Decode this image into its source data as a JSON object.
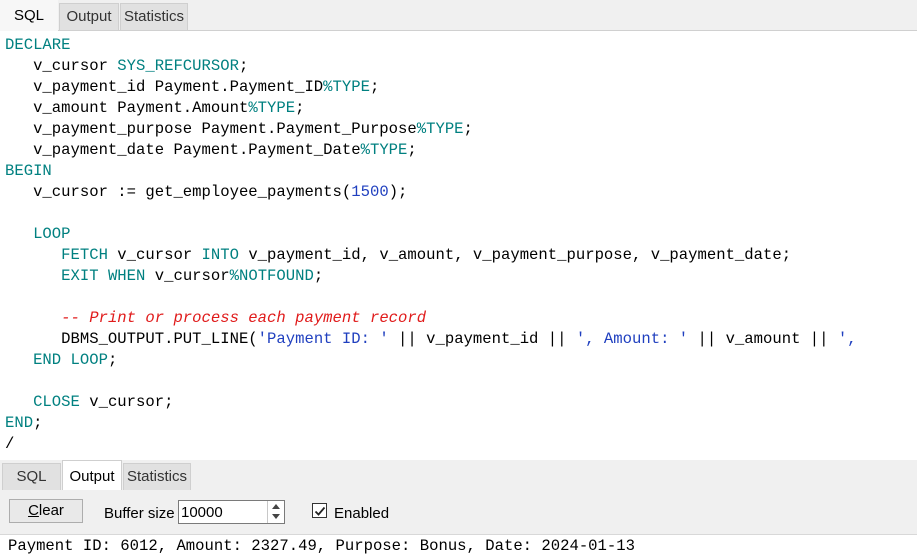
{
  "top_tabs": [
    {
      "label": "SQL",
      "active": true
    },
    {
      "label": "Output",
      "active": false
    },
    {
      "label": "Statistics",
      "active": false
    }
  ],
  "code": {
    "l1": "DECLARE",
    "l2a": "   v_cursor ",
    "l2b": "SYS_REFCURSOR",
    "l2c": ";",
    "l3a": "   v_payment_id Payment.Payment_ID",
    "l3b": "%TYPE",
    "l3c": ";",
    "l4a": "   v_amount Payment.Amount",
    "l4b": "%TYPE",
    "l4c": ";",
    "l5a": "   v_payment_purpose Payment.Payment_Purpose",
    "l5b": "%TYPE",
    "l5c": ";",
    "l6a": "   v_payment_date Payment.Payment_Date",
    "l6b": "%TYPE",
    "l6c": ";",
    "l7": "BEGIN",
    "l8a": "   v_cursor := get_employee_payments(",
    "l8b": "1500",
    "l8c": ");",
    "l10a": "   ",
    "l10b": "LOOP",
    "l11a": "      ",
    "l11b": "FETCH",
    "l11c": " v_cursor ",
    "l11d": "INTO",
    "l11e": " v_payment_id, v_amount, v_payment_purpose, v_payment_date;",
    "l12a": "      ",
    "l12b": "EXIT WHEN",
    "l12c": " v_cursor",
    "l12d": "%NOTFOUND",
    "l12e": ";",
    "l14a": "      ",
    "l14b": "-- Print or process each payment record",
    "l15a": "      DBMS_OUTPUT.PUT_LINE(",
    "l15b": "'Payment ID: '",
    "l15c": " || v_payment_id || ",
    "l15d": "', Amount: '",
    "l15e": " || v_amount || ",
    "l15f": "',",
    "l16a": "   ",
    "l16b": "END LOOP",
    "l16c": ";",
    "l18a": "   ",
    "l18b": "CLOSE",
    "l18c": " v_cursor;",
    "l19a": "END",
    "l19b": ";",
    "l20": "/"
  },
  "bottom_tabs": [
    {
      "label": "SQL",
      "active": false
    },
    {
      "label": "Output",
      "active": true
    },
    {
      "label": "Statistics",
      "active": false
    }
  ],
  "toolbar": {
    "clear_label_mnemonic": "C",
    "clear_label_rest": "lear",
    "buffer_label": "Buffer size",
    "buffer_value": "10000",
    "enabled_label": "Enabled",
    "enabled_checked": true
  },
  "output": {
    "line1": "Payment ID: 6012, Amount: 2327.49, Purpose: Bonus, Date: 2024-01-13"
  },
  "colors": {
    "keyword": "#008080",
    "string": "#1f3fbf",
    "comment": "#e01b1b"
  }
}
